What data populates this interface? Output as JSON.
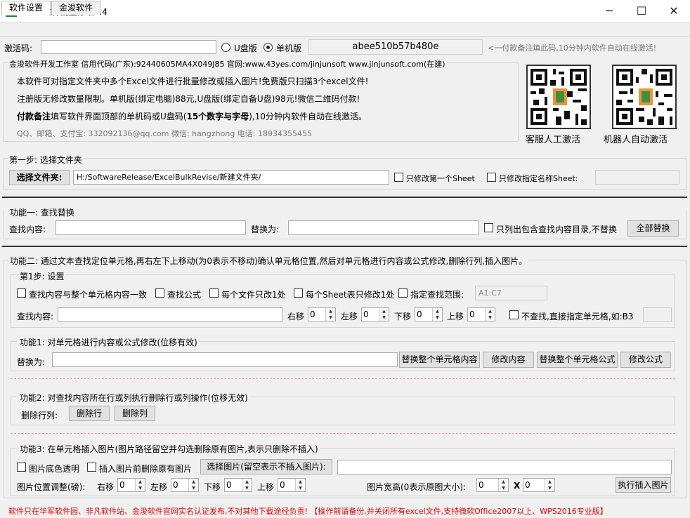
{
  "window": {
    "title": "Excel文件批量修改6.4",
    "minimize": "─",
    "maximize": "☐",
    "close": "✕"
  },
  "tabs": [
    "软件设置",
    "金浚软件"
  ],
  "activation": {
    "code_label": "激活码:",
    "usb_label": "U盘版",
    "pc_label": "单机版",
    "machine_code": "abee510b57b480e",
    "hint": "<一付款备注填此码,10分钟内软件自动在线激活!"
  },
  "info": {
    "company": "金浚软件开发工作室 信用代码(广东):92440605MA4X049J85 官网:www.43yes.com/jinjunsoft  www.jinjunsoft.com(在建)",
    "line1": "本软件可对指定文件夹中多个Excel文件进行批量修改或插入图片!免费版只扫描3个excel文件!",
    "line2": "注册版无修改数量限制。单机版(绑定电脑)88元,U盘版(绑定自备U盘)98元!微信二维码付款!",
    "line3_bold": "付款备注",
    "line3_a": "填写软件界面顶部的单机码或U盘码(",
    "line3_bold2": "15个数字与字母",
    "line3_b": "),10分钟内软件自动在线激活。",
    "contact": "QQ、邮箱、支付宝: 332092136@qq.com   微信: hangzhong   电话: 18934355455",
    "qr1_label": "客服人工激活",
    "qr2_label": "机器人自动激活"
  },
  "step1": {
    "legend": "第一步: 选择文件夹",
    "select_button": "选择文件夹:",
    "path": "H:/SoftwareRelease/ExcelBulkRevise/新建文件夹/",
    "only_first_sheet": "只修改第一个Sheet",
    "only_named_sheet": "只修改指定名称Sheet:"
  },
  "func1": {
    "legend": "功能一: 查找替换",
    "find_label": "查找内容:",
    "replace_label": "替换为:",
    "list_only": "只列出包含查找内容目录,不替换",
    "replace_all_button": "全部替换"
  },
  "func2": {
    "legend": "功能二: 通过文本查找定位单元格,再右左下上移动(为0表示不移动)确认单元格位置,然后对单元格进行内容或公式修改,删除行列,插入图片。",
    "sub_step": {
      "legend": "第1步: 设置",
      "match_whole": "查找内容与整个单元格内容一致",
      "find_formula": "查找公式",
      "once_per_file": "每个文件只改1处",
      "once_per_sheet": "每个Sheet表只修改1处",
      "range_label": "指定查找范围:",
      "range_value": "A1:C7",
      "find_label": "查找内容:",
      "right_label": "右移",
      "left_label": "左移",
      "down_label": "下移",
      "up_label": "上移",
      "right": "0",
      "left": "0",
      "down": "0",
      "up": "0",
      "no_find": "不查找,直接指定单元格,如:B3"
    },
    "f1": {
      "legend": "功能1: 对单元格进行内容或公式修改(位移有效)",
      "replace_label": "替换为:",
      "b1": "替换整个单元格内容",
      "b2": "修改内容",
      "b3": "替换整个单元格公式",
      "b4": "修改公式"
    },
    "f2": {
      "legend": "功能2: 对查找内容所在行或列执行删除行或列操作(位移无效)",
      "label": "删除行列:",
      "b1": "删除行",
      "b2": "删除列"
    },
    "f3": {
      "legend": "功能3: 在单元格插入图片(图片路径留空并勾选删除原有图片,表示只删除不插入)",
      "transparent": "图片底色透明",
      "delete_existing": "插入图片前删除原有图片",
      "select_image": "选择图片(留空表示不插入图片):",
      "position_label": "图片位置调整(磅):",
      "right_label": "右移",
      "left_label": "左移",
      "down_label": "下移",
      "up_label": "上移",
      "right": "0",
      "left": "0",
      "down": "0",
      "up": "0",
      "size_label": "图片宽高(0表示原图大小):",
      "width": "0",
      "x": "X",
      "height": "0",
      "insert_button": "执行插入图片"
    }
  },
  "footer": "软件只在华军软件园、非凡软件站、金浚软件官网实名认证发布,不对其他下载途径负责! 【操作前请备份,并关闭所有excel文件,支持微软Office2007以上、WPS2016专业版】"
}
